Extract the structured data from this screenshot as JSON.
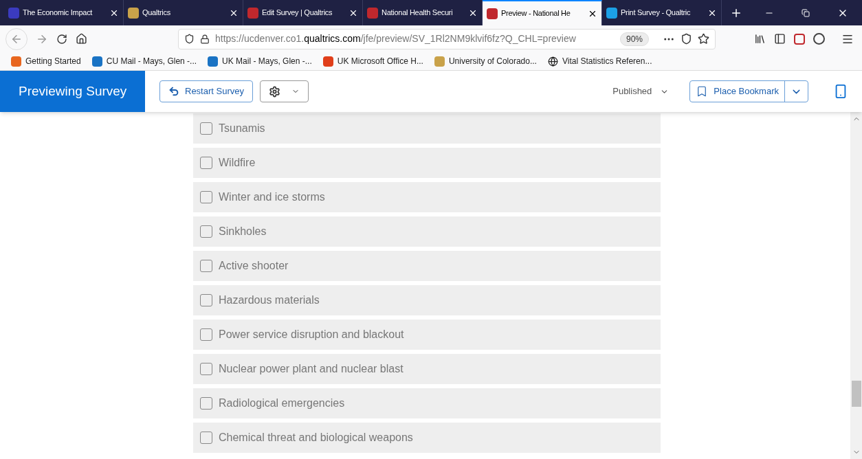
{
  "tabs": [
    {
      "title": "The Economic Impact",
      "selected": false
    },
    {
      "title": "Qualtrics",
      "selected": false
    },
    {
      "title": "Edit Survey | Qualtrics",
      "selected": false
    },
    {
      "title": "National Health Securi",
      "selected": false
    },
    {
      "title": "Preview - National He",
      "selected": true
    },
    {
      "title": "Print Survey - Qualtric",
      "selected": false
    }
  ],
  "address": {
    "prefix": "https://ucdenver.co1.",
    "domain": "qualtrics.com",
    "path": "/jfe/preview/SV_1Rl2NM9klvif6fz?Q_CHL=preview",
    "zoom": "90%"
  },
  "bookmarks": [
    "Getting Started",
    "CU Mail - Mays, Glen -...",
    "UK Mail - Mays, Glen -...",
    "UK Microsoft Office H...",
    "University of Colorado...",
    "Vital Statistics Referen..."
  ],
  "header": {
    "title": "Previewing Survey",
    "restart": "Restart Survey",
    "status": "Published",
    "bookmark": "Place Bookmark"
  },
  "choices": [
    {
      "label": "Tsunamis",
      "checked": false
    },
    {
      "label": "Wildfire",
      "checked": false
    },
    {
      "label": "Winter and ice storms",
      "checked": false
    },
    {
      "label": "Sinkholes",
      "checked": false
    },
    {
      "label": "Active shooter",
      "checked": false
    },
    {
      "label": "Hazardous materials",
      "checked": false
    },
    {
      "label": "Power service disruption and blackout",
      "checked": false
    },
    {
      "label": "Nuclear power plant and nuclear blast",
      "checked": false
    },
    {
      "label": "Radiological emergencies",
      "checked": false
    },
    {
      "label": "Chemical threat and biological weapons",
      "checked": false
    }
  ]
}
